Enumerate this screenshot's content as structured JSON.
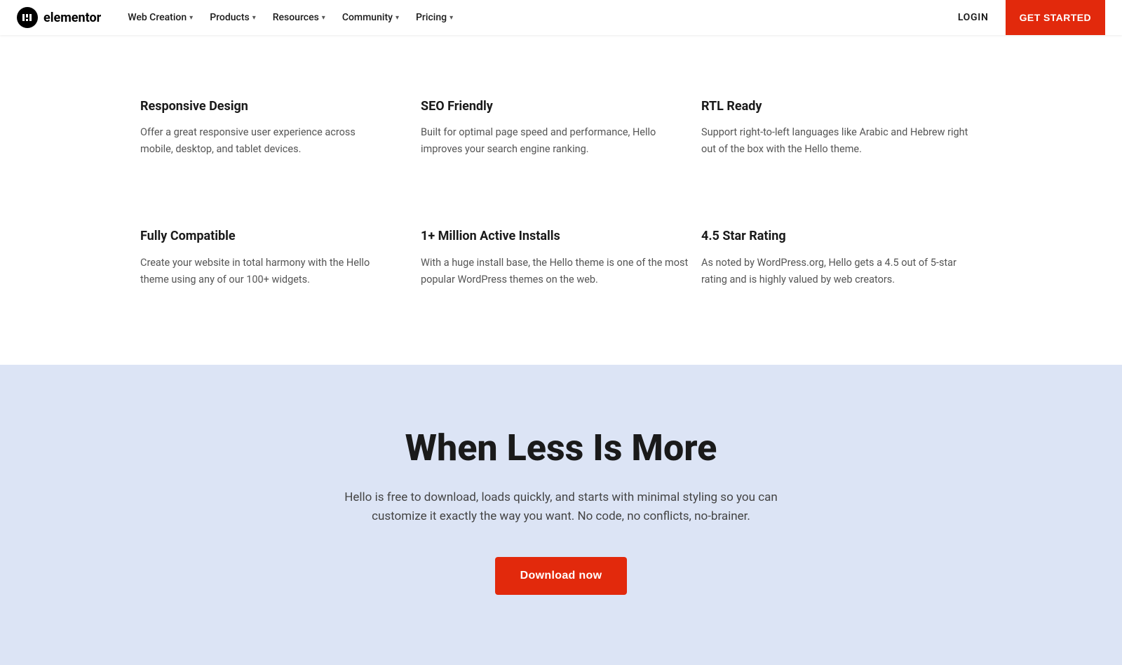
{
  "navbar": {
    "logo_text": "elementor",
    "logo_icon": "e",
    "items": [
      {
        "label": "Web Creation",
        "has_dropdown": true
      },
      {
        "label": "Products",
        "has_dropdown": true
      },
      {
        "label": "Resources",
        "has_dropdown": true
      },
      {
        "label": "Community",
        "has_dropdown": true
      },
      {
        "label": "Pricing",
        "has_dropdown": true
      }
    ],
    "login_label": "LOGIN",
    "get_started_label": "GET STARTED"
  },
  "features": {
    "row1": [
      {
        "title": "Responsive Design",
        "description": "Offer a great responsive user experience across mobile, desktop, and tablet devices."
      },
      {
        "title": "SEO Friendly",
        "description": "Built for optimal page speed and performance, Hello improves your search engine ranking."
      },
      {
        "title": "RTL Ready",
        "description": "Support right-to-left languages like Arabic and Hebrew right out of the box with the Hello theme."
      }
    ],
    "row2": [
      {
        "title": "Fully Compatible",
        "description": "Create your website in total harmony with the Hello theme using any of our 100+ widgets."
      },
      {
        "title": "1+ Million Active Installs",
        "description": "With a huge install base, the Hello theme is one of the most popular WordPress themes on the web."
      },
      {
        "title": "4.5 Star Rating",
        "description": "As noted by WordPress.org, Hello gets a 4.5 out of 5-star rating and is highly valued by web creators."
      }
    ]
  },
  "cta": {
    "title": "When Less Is More",
    "description": "Hello is free to download, loads quickly, and starts with minimal styling so you can customize it exactly the way you want. No code, no conflicts, no-brainer.",
    "button_label": "Download now"
  }
}
